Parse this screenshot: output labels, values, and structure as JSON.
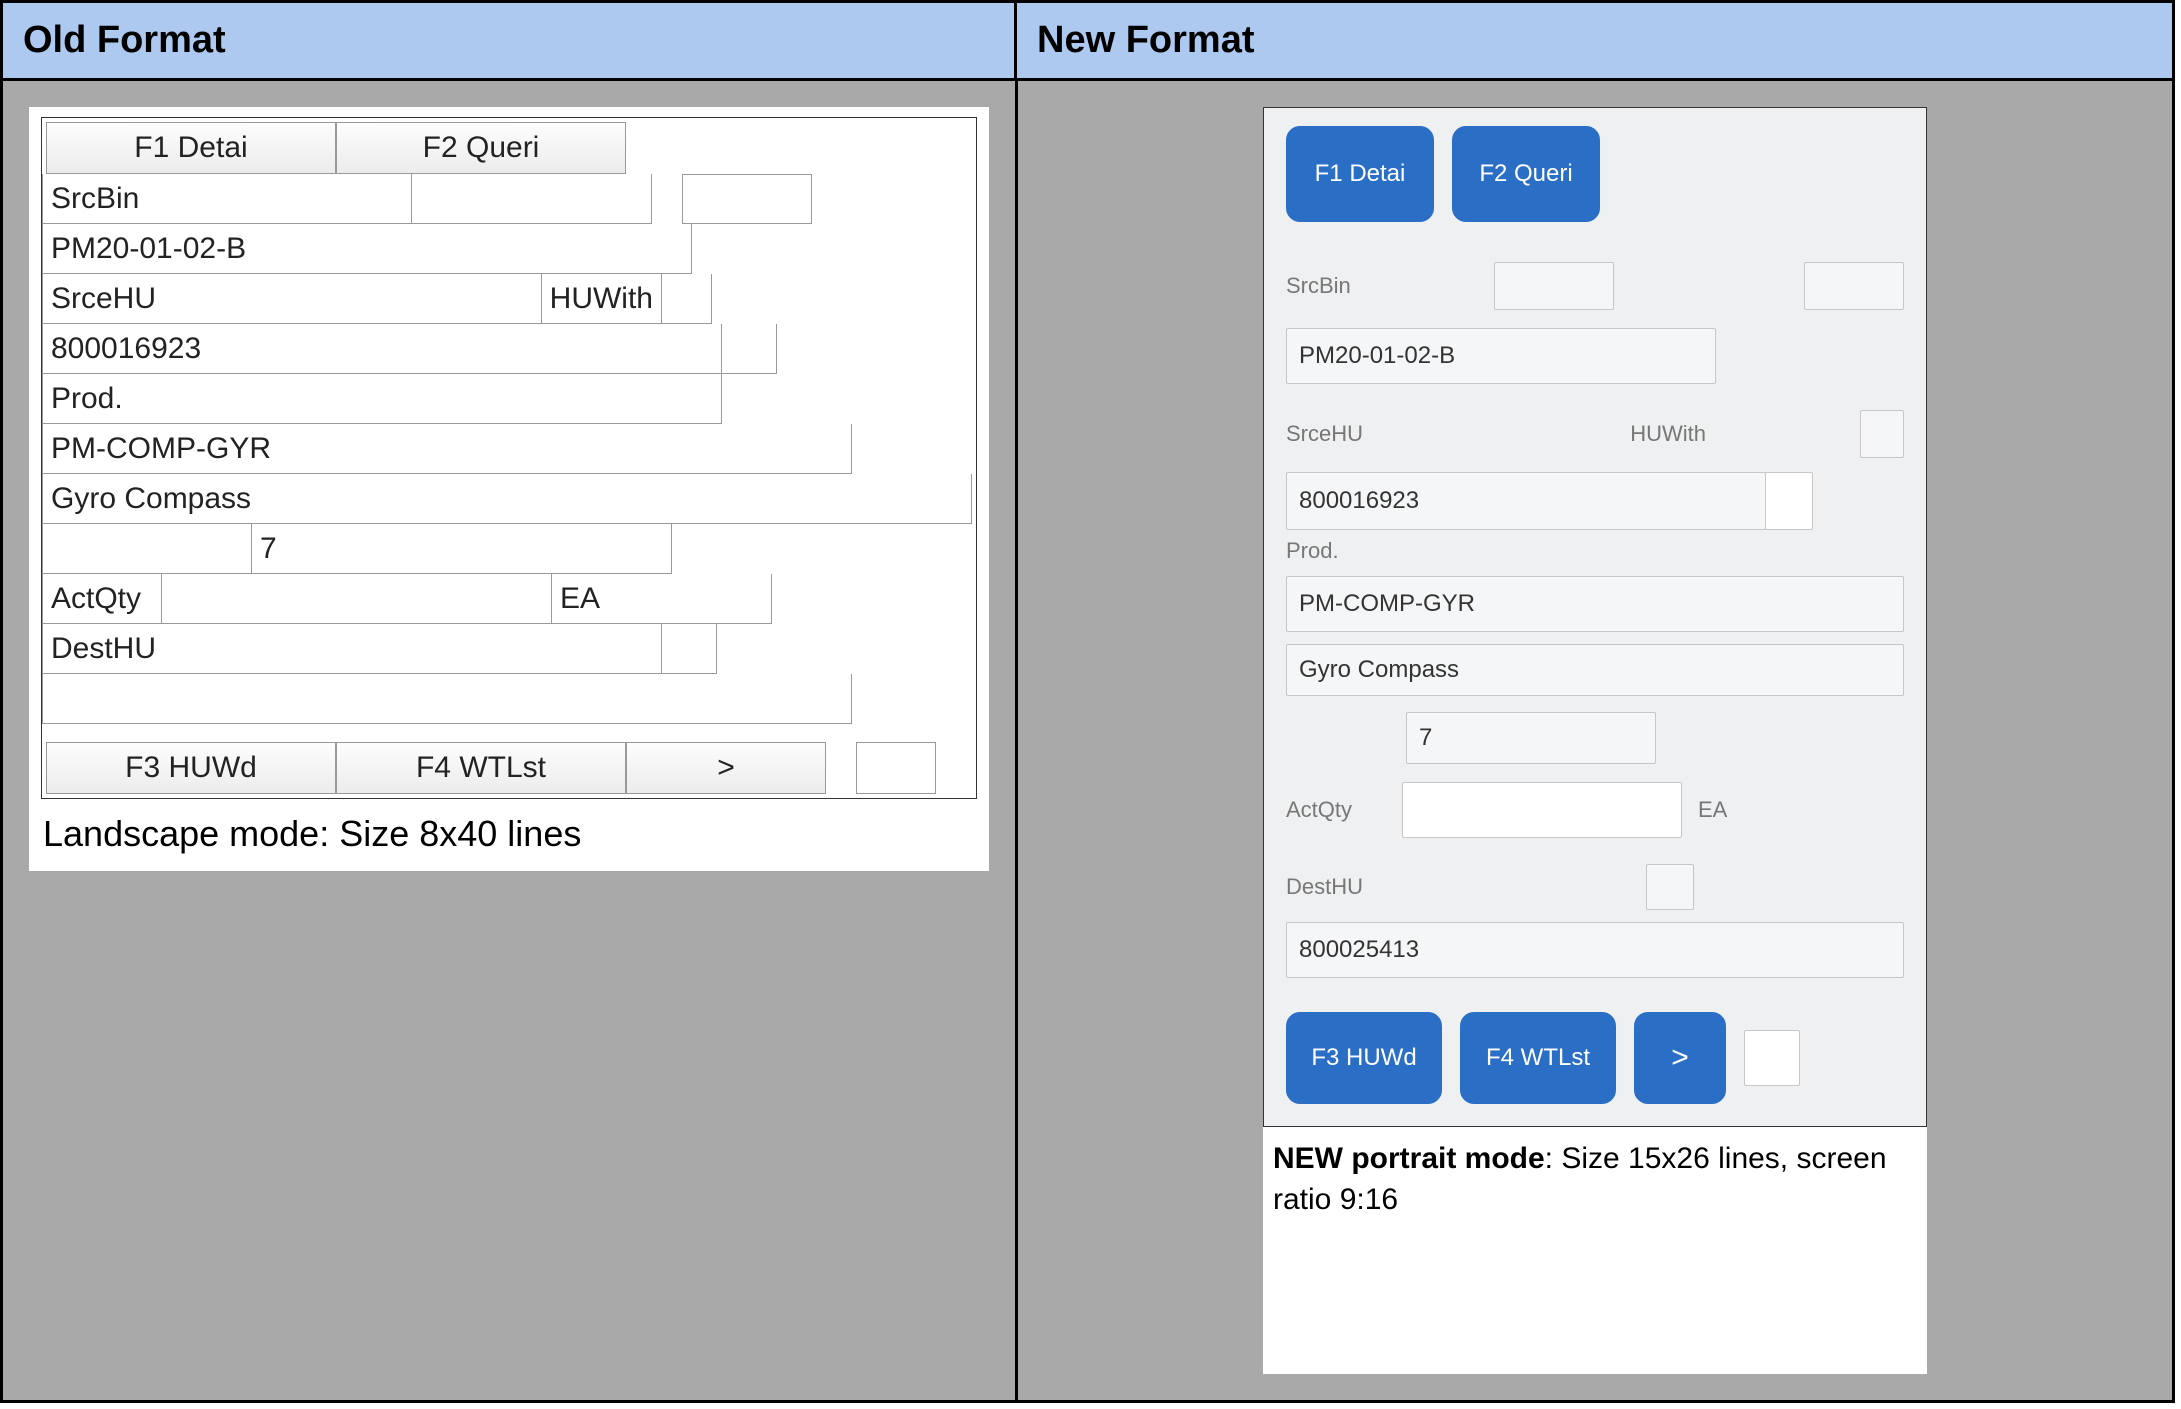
{
  "header": {
    "old": "Old Format",
    "new": "New Format"
  },
  "old": {
    "buttons": {
      "f1": "F1 Detai",
      "f2": "F2 Queri",
      "f3": "F3 HUWd",
      "f4": "F4 WTLst",
      "more": ">"
    },
    "labels": {
      "srcbin": "SrcBin",
      "srcehu": "SrceHU",
      "huwith": "HUWith",
      "prod": "Prod.",
      "actqty": "ActQty",
      "ea": "EA",
      "desthu": "DestHU"
    },
    "values": {
      "bin": "PM20-01-02-B",
      "hu": "800016923",
      "prod": "PM-COMP-GYR",
      "desc": "Gyro Compass",
      "qty": "7"
    },
    "caption": "Landscape mode: Size 8x40 lines"
  },
  "new": {
    "buttons": {
      "f1": "F1 Detai",
      "f2": "F2 Queri",
      "f3": "F3 HUWd",
      "f4": "F4 WTLst",
      "more": ">"
    },
    "labels": {
      "srcbin": "SrcBin",
      "srcehu": "SrceHU",
      "huwith": "HUWith",
      "prod": "Prod.",
      "actqty": "ActQty",
      "ea": "EA",
      "desthu": "DestHU"
    },
    "values": {
      "bin": "PM20-01-02-B",
      "hu": "800016923",
      "prod": "PM-COMP-GYR",
      "desc": "Gyro Compass",
      "qty": "7",
      "desthu_val": "800025413"
    },
    "caption_bold": "NEW portrait mode",
    "caption_rest": ": Size 15x26 lines, screen ratio 9:16"
  }
}
